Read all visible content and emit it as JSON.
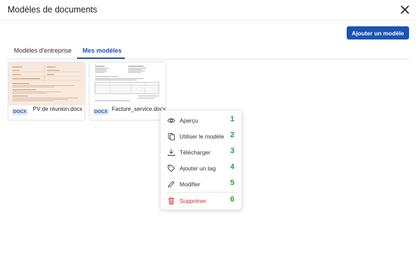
{
  "header": {
    "title": "Modèles de documents",
    "close_icon": "close-icon"
  },
  "toolbar": {
    "add_label": "Ajouter un modèle",
    "accent": "#1c54b2"
  },
  "tabs": [
    {
      "label": "Modèles d'entreprise",
      "active": false
    },
    {
      "label": "Mes modèles",
      "active": true
    }
  ],
  "documents": [
    {
      "type": "DOCX",
      "name": "PV de réunion.docx",
      "thumbnail": "beige"
    },
    {
      "type": "DOCX",
      "name": "Facture_service.docx",
      "thumbnail": "white"
    }
  ],
  "context_menu": {
    "items": [
      {
        "label": "Aperçu",
        "number": "1",
        "icon": "eye-icon"
      },
      {
        "label": "Utiliser le modèle",
        "number": "2",
        "icon": "copy-icon"
      },
      {
        "label": "Télécharger",
        "number": "3",
        "icon": "download-icon"
      },
      {
        "label": "Ajouter un tag",
        "number": "4",
        "icon": "tag-icon"
      },
      {
        "label": "Modifier",
        "number": "5",
        "icon": "pencil-icon"
      },
      {
        "label": "Supprimer",
        "number": "6",
        "icon": "trash-icon",
        "danger": true
      }
    ],
    "number_color": "#1ea32c",
    "danger_color": "#d42b2b"
  }
}
